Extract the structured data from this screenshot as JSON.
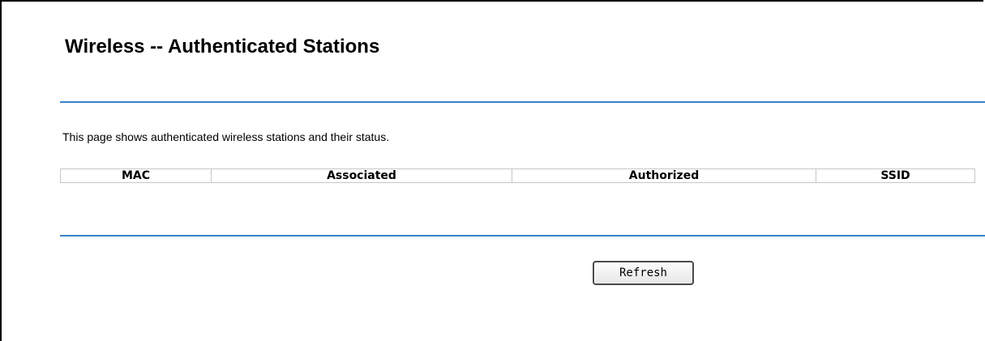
{
  "page": {
    "title": "Wireless -- Authenticated Stations",
    "description": "This page shows authenticated wireless stations and their status."
  },
  "table": {
    "columns": [
      "MAC",
      "Associated",
      "Authorized",
      "SSID"
    ],
    "rows": []
  },
  "actions": {
    "refresh_label": "Refresh"
  },
  "colors": {
    "rule": "#3a83c6",
    "table_border": "#c7c7c7",
    "background": "#ffffff"
  }
}
